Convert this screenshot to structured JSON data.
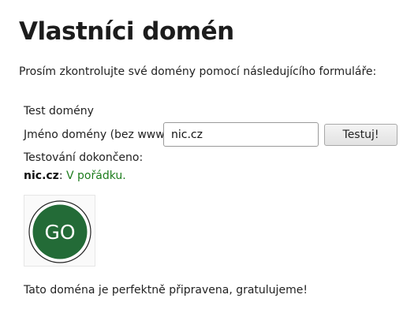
{
  "page": {
    "title": "Vlastníci domén",
    "intro": "Prosím zkontrolujte své domény pomocí následujícího formuláře:"
  },
  "form": {
    "heading": "Test domény",
    "field_label": "Jméno domény (bez www):",
    "domain_value": "nic.cz",
    "submit_label": "Testuj!"
  },
  "result": {
    "status": "Testování dokončeno:",
    "domain": "nic.cz",
    "separator": ": ",
    "verdict": "V pořádku.",
    "badge_text": "GO",
    "closing": "Tato doména je perfektně připravena, gratulujeme!"
  },
  "colors": {
    "badge_green": "#236b37",
    "ok_text": "#1e7d1e"
  },
  "icons": {
    "badge": "go-badge-icon"
  }
}
